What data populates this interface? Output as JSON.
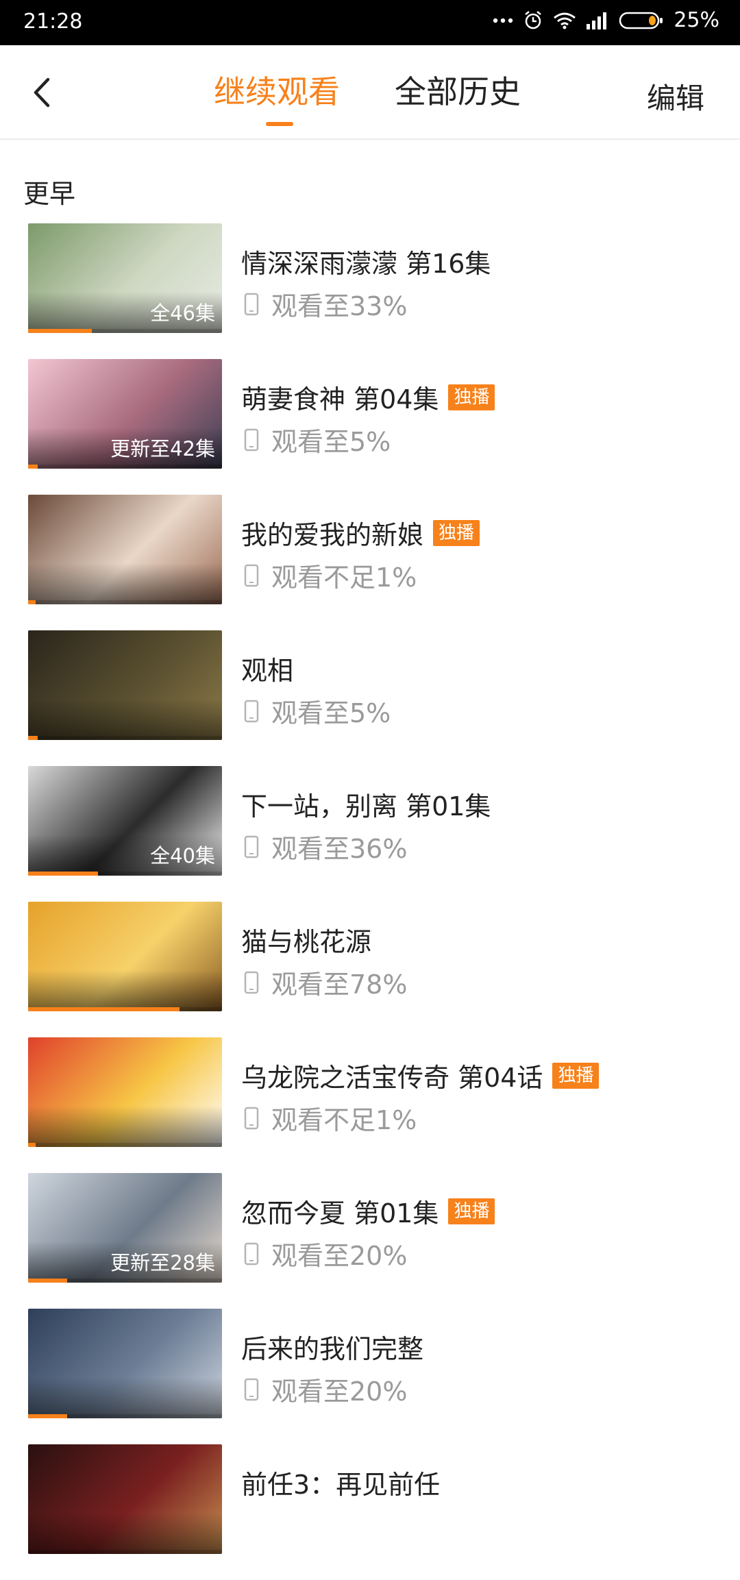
{
  "status": {
    "time": "21:28",
    "battery": "25%"
  },
  "header": {
    "back_icon": "chevron-left-icon",
    "tab_continue": "继续观看",
    "tab_history": "全部历史",
    "edit": "编辑"
  },
  "section": {
    "title": "更早"
  },
  "colors": {
    "accent": "#f7811a"
  },
  "items": [
    {
      "title": "情深深雨濛濛 第16集",
      "exclusive": "",
      "episode_badge": "全46集",
      "progress_text": "观看至33%",
      "progress": 0.33,
      "thumb": [
        "#7d9a6a",
        "#cfd8c3",
        "#e8ebe3"
      ]
    },
    {
      "title": "萌妻食神 第04集",
      "exclusive": "独播",
      "episode_badge": "更新至42集",
      "progress_text": "观看至5%",
      "progress": 0.05,
      "thumb": [
        "#f2c6d2",
        "#a76a7d",
        "#3c3f55"
      ]
    },
    {
      "title": "我的爱我的新娘",
      "exclusive": "独播",
      "episode_badge": "",
      "progress_text": "观看不足1%",
      "progress": 0.01,
      "thumb": [
        "#6b4a3a",
        "#e9d7c8",
        "#9b6c55"
      ]
    },
    {
      "title": "观相",
      "exclusive": "",
      "episode_badge": "",
      "progress_text": "观看至5%",
      "progress": 0.05,
      "thumb": [
        "#2a251c",
        "#5a5030",
        "#8c7a48"
      ]
    },
    {
      "title": "下一站，别离 第01集",
      "exclusive": "",
      "episode_badge": "全40集",
      "progress_text": "观看至36%",
      "progress": 0.36,
      "thumb": [
        "#d9d9d9",
        "#2b2b2b",
        "#f4f4f4"
      ]
    },
    {
      "title": "猫与桃花源",
      "exclusive": "",
      "episode_badge": "",
      "progress_text": "观看至78%",
      "progress": 0.78,
      "thumb": [
        "#e6a22a",
        "#f6d16a",
        "#8b5e25"
      ]
    },
    {
      "title": "乌龙院之活宝传奇 第04话",
      "exclusive": "独播",
      "episode_badge": "",
      "progress_text": "观看不足1%",
      "progress": 0.01,
      "thumb": [
        "#e0412c",
        "#f7c646",
        "#ffffff"
      ]
    },
    {
      "title": "忽而今夏 第01集",
      "exclusive": "独播",
      "episode_badge": "更新至28集",
      "progress_text": "观看至20%",
      "progress": 0.2,
      "thumb": [
        "#cfd6de",
        "#6f7b8a",
        "#e9ddd0"
      ]
    },
    {
      "title": "后来的我们完整",
      "exclusive": "",
      "episode_badge": "",
      "progress_text": "观看至20%",
      "progress": 0.2,
      "thumb": [
        "#2e3f5a",
        "#6d7e96",
        "#cfd6e0"
      ]
    },
    {
      "title": "前任3：再见前任",
      "exclusive": "",
      "episode_badge": "",
      "progress_text": "",
      "progress": 0.0,
      "thumb": [
        "#2a1010",
        "#7a2020",
        "#c79050"
      ]
    }
  ]
}
